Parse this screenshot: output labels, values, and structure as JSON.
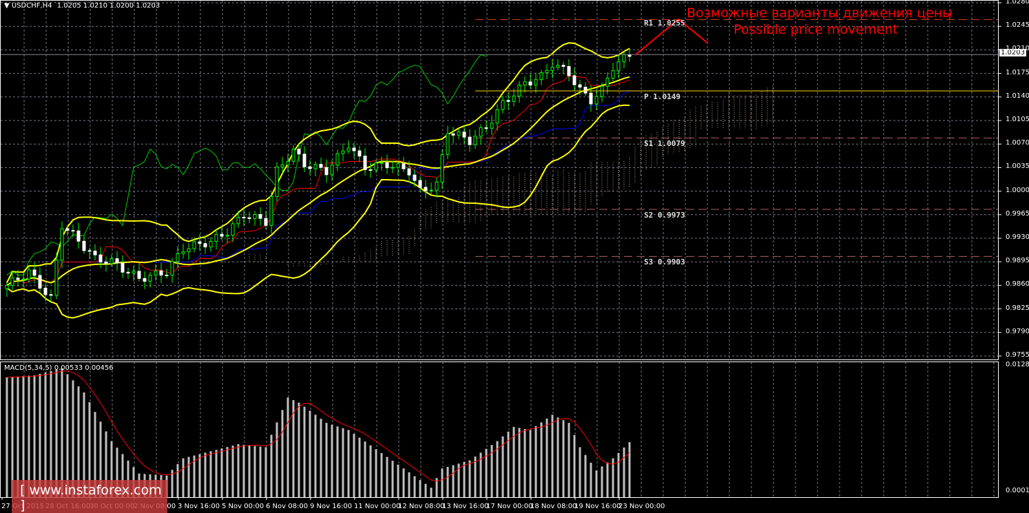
{
  "header": {
    "symbol": "USDCHF,H4",
    "ohlc": "1.0205 1.0210 1.0200 1.0203"
  },
  "current_price": "1.0203",
  "price_axis": [
    "1.0280",
    "1.0245",
    "1.0210",
    "1.0175",
    "1.0140",
    "1.0105",
    "1.0070",
    "1.0035",
    "1.0000",
    "0.9965",
    "0.9930",
    "0.9895",
    "0.9860",
    "0.9825",
    "0.9790",
    "0.9755"
  ],
  "macd_axis": {
    "top": "0.01285",
    "bottom": "0.00014",
    "zero": "0.00"
  },
  "macd_label": "MACD(5,34,5) 0.00533 0.00456",
  "time_axis": [
    "27 Oct 2015",
    "28 Oct 16:00",
    "30 Oct 00:00",
    "2 Nov 08:00",
    "3 Nov 16:00",
    "5 Nov 00:00",
    "6 Nov 08:00",
    "9 Nov 16:00",
    "11 Nov 00:00",
    "12 Nov 08:00",
    "13 Nov 16:00",
    "17 Nov 00:00",
    "18 Nov 08:00",
    "19 Nov 16:00",
    "23 Nov 00:00"
  ],
  "pivots": [
    {
      "label": "R1  1.0255",
      "value": 1.0255,
      "color": "#e0401a",
      "dashed": true
    },
    {
      "label": "P  1.0149",
      "value": 1.0149,
      "color": "#ffd700",
      "dashed": false
    },
    {
      "label": "S1  1.0079",
      "value": 1.0079,
      "color": "#b06060",
      "dashed": true
    },
    {
      "label": "S2  0.9973",
      "value": 0.9973,
      "color": "#b06060",
      "dashed": true
    },
    {
      "label": "S3  0.9903",
      "value": 0.9903,
      "color": "#b06060",
      "dashed": true
    }
  ],
  "annotation": {
    "ru": "Возможные варианты движения цены",
    "en": "Possible price movement",
    "color": "#ff0000"
  },
  "logo": "[ www.instaforex.com ]",
  "colors": {
    "bollinger": "#ffff00",
    "tenkan": "#ff0000",
    "kijun": "#0000ff",
    "chikou": "#00cc00",
    "cloud": "#c0a080",
    "macd_hist": "#c0c0c0",
    "macd_signal": "#ff0000"
  },
  "chart_data": {
    "type": "candlestick",
    "title": "USDCHF, H4",
    "ylim": [
      0.9755,
      1.028
    ],
    "indicators": [
      "Bollinger Bands",
      "Ichimoku",
      "Pivot points",
      "MACD(5,34,5)"
    ],
    "close_anchors": [
      [
        0,
        0.986
      ],
      [
        4,
        0.988
      ],
      [
        8,
        0.984
      ],
      [
        10,
        0.995
      ],
      [
        12,
        0.9935
      ],
      [
        16,
        0.99
      ],
      [
        19,
        0.9895
      ],
      [
        24,
        0.987
      ],
      [
        29,
        0.988
      ],
      [
        32,
        0.9915
      ],
      [
        37,
        0.9925
      ],
      [
        40,
        0.994
      ],
      [
        43,
        0.9965
      ],
      [
        47,
        0.9955
      ],
      [
        49,
        1.003
      ],
      [
        52,
        1.006
      ],
      [
        54,
        1.004
      ],
      [
        58,
        1.003
      ],
      [
        62,
        1.007
      ],
      [
        65,
        1.0035
      ],
      [
        69,
        1.004
      ],
      [
        73,
        1.003
      ],
      [
        75,
        1.0
      ],
      [
        78,
        1.001
      ],
      [
        80,
        1.009
      ],
      [
        84,
        1.0075
      ],
      [
        87,
        1.0095
      ],
      [
        90,
        1.013
      ],
      [
        94,
        1.016
      ],
      [
        97,
        1.017
      ],
      [
        99,
        1.019
      ],
      [
        102,
        1.0175
      ],
      [
        104,
        1.015
      ],
      [
        106,
        1.0135
      ],
      [
        108,
        1.015
      ],
      [
        110,
        1.0185
      ],
      [
        113,
        1.0203
      ]
    ],
    "macd_hist_anchors": [
      [
        0,
        0.0117
      ],
      [
        5,
        0.0119
      ],
      [
        10,
        0.0126
      ],
      [
        14,
        0.0102
      ],
      [
        19,
        0.0054
      ],
      [
        24,
        0.0022
      ],
      [
        29,
        0.002
      ],
      [
        32,
        0.0037
      ],
      [
        37,
        0.0044
      ],
      [
        42,
        0.0051
      ],
      [
        47,
        0.0048
      ],
      [
        51,
        0.0097
      ],
      [
        53,
        0.0092
      ],
      [
        58,
        0.0072
      ],
      [
        62,
        0.0065
      ],
      [
        67,
        0.0046
      ],
      [
        72,
        0.0027
      ],
      [
        77,
        0.0008
      ],
      [
        79,
        0.0027
      ],
      [
        84,
        0.0035
      ],
      [
        89,
        0.0054
      ],
      [
        92,
        0.0068
      ],
      [
        95,
        0.0065
      ],
      [
        99,
        0.008
      ],
      [
        102,
        0.0072
      ],
      [
        104,
        0.0048
      ],
      [
        107,
        0.0025
      ],
      [
        110,
        0.0037
      ],
      [
        113,
        0.0053
      ]
    ]
  }
}
